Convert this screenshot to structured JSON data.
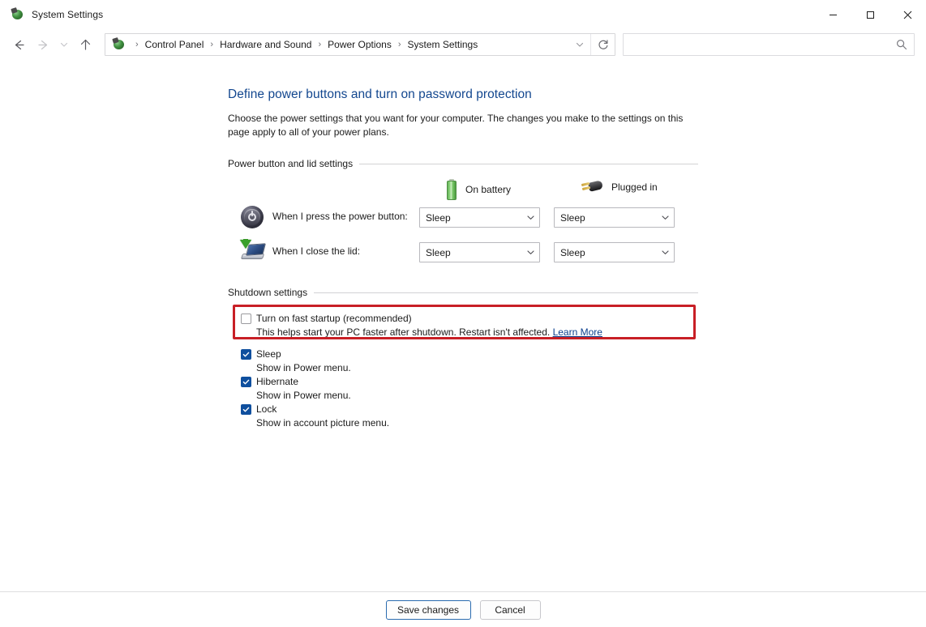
{
  "window": {
    "title": "System Settings",
    "icon": "control-panel-icon",
    "controls": {
      "minimize": "Minimize",
      "maximize": "Maximize",
      "close": "Close"
    }
  },
  "toolbar": {
    "back": "Back",
    "forward": "Forward",
    "recent": "Recent locations",
    "up": "Up one level",
    "refresh": "Refresh",
    "breadcrumb_chevron": "Previous locations"
  },
  "breadcrumb": {
    "items": [
      "Control Panel",
      "Hardware and Sound",
      "Power Options",
      "System Settings"
    ],
    "separator": "›"
  },
  "search": {
    "value": "",
    "placeholder": "",
    "icon": "search-icon"
  },
  "page": {
    "title": "Define power buttons and turn on password protection",
    "description": "Choose the power settings that you want for your computer. The changes you make to the settings on this page apply to all of your power plans."
  },
  "power_section": {
    "legend": "Power button and lid settings",
    "columns": [
      {
        "label": "On battery",
        "icon": "battery-icon"
      },
      {
        "label": "Plugged in",
        "icon": "power-plug-icon"
      }
    ],
    "rows": [
      {
        "icon": "power-button-icon",
        "label": "When I press the power button:",
        "on_battery": "Sleep",
        "plugged_in": "Sleep"
      },
      {
        "icon": "laptop-lid-icon",
        "label": "When I close the lid:",
        "on_battery": "Sleep",
        "plugged_in": "Sleep"
      }
    ]
  },
  "shutdown_section": {
    "legend": "Shutdown settings",
    "fast_startup": {
      "label": "Turn on fast startup (recommended)",
      "checked": false,
      "description": "This helps start your PC faster after shutdown. Restart isn't affected.",
      "link": "Learn More",
      "highlighted": true
    },
    "options": [
      {
        "label": "Sleep",
        "description": "Show in Power menu.",
        "checked": true
      },
      {
        "label": "Hibernate",
        "description": "Show in Power menu.",
        "checked": true
      },
      {
        "label": "Lock",
        "description": "Show in account picture menu.",
        "checked": true
      }
    ]
  },
  "footer": {
    "save": "Save changes",
    "cancel": "Cancel"
  },
  "colors": {
    "title_link": "#13478f",
    "highlight": "#c81f26",
    "checkbox_checked": "#0f4f9e",
    "link": "#0b3f8f",
    "default_button_border": "#2b6cb0"
  }
}
